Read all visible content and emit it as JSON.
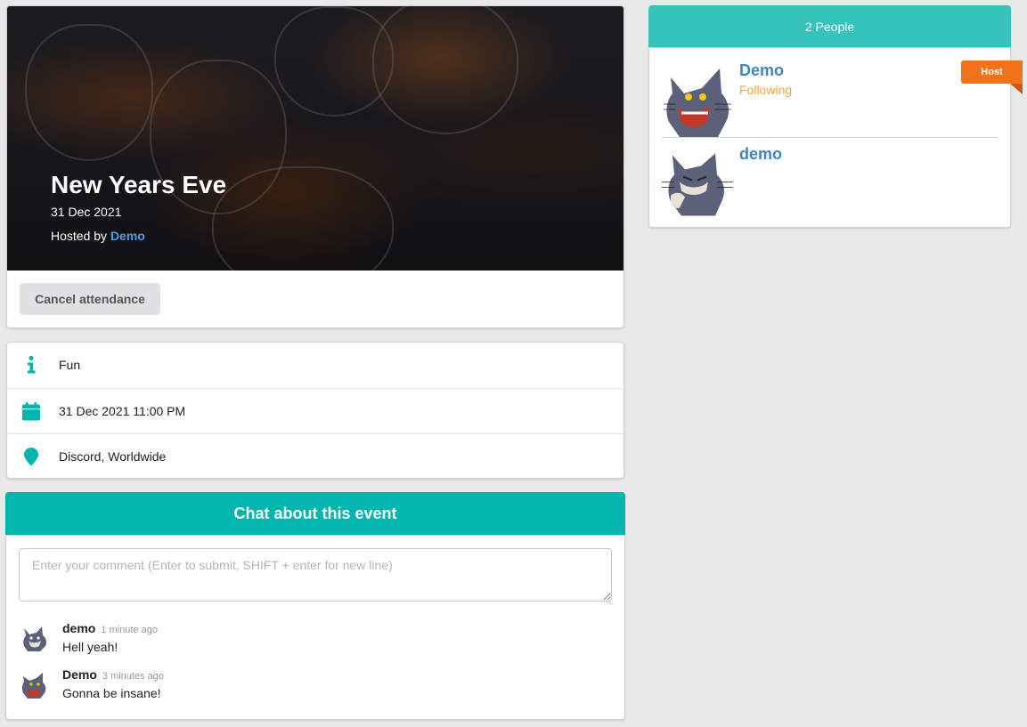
{
  "event": {
    "title": "New Years Eve",
    "date": "31 Dec 2021",
    "hosted_prefix": "Hosted by",
    "host_name": "Demo",
    "cancel_label": "Cancel attendance"
  },
  "details": {
    "description": "Fun",
    "datetime": "31 Dec 2021 11:00 PM",
    "location": "Discord, Worldwide"
  },
  "chat": {
    "title": "Chat about this event",
    "placeholder": "Enter your comment (Enter to submit, SHIFT + enter for new line)",
    "comments": [
      {
        "author": "demo",
        "time": "1 minute ago",
        "text": "Hell yeah!"
      },
      {
        "author": "Demo",
        "time": "3 minutes ago",
        "text": "Gonna be insane!"
      }
    ]
  },
  "people": {
    "header": "2 People",
    "list": [
      {
        "name": "Demo",
        "status": "Following",
        "badge": "Host"
      },
      {
        "name": "demo",
        "status": ""
      }
    ]
  },
  "colors": {
    "teal": "#00b5ad",
    "teal_light": "#35c4bc",
    "link_blue": "#4183c4",
    "following_orange": "#f2a23a",
    "host_orange": "#f2711c"
  },
  "icons": {
    "description": "info-icon",
    "datetime": "calendar-icon",
    "location": "map-marker-icon"
  }
}
